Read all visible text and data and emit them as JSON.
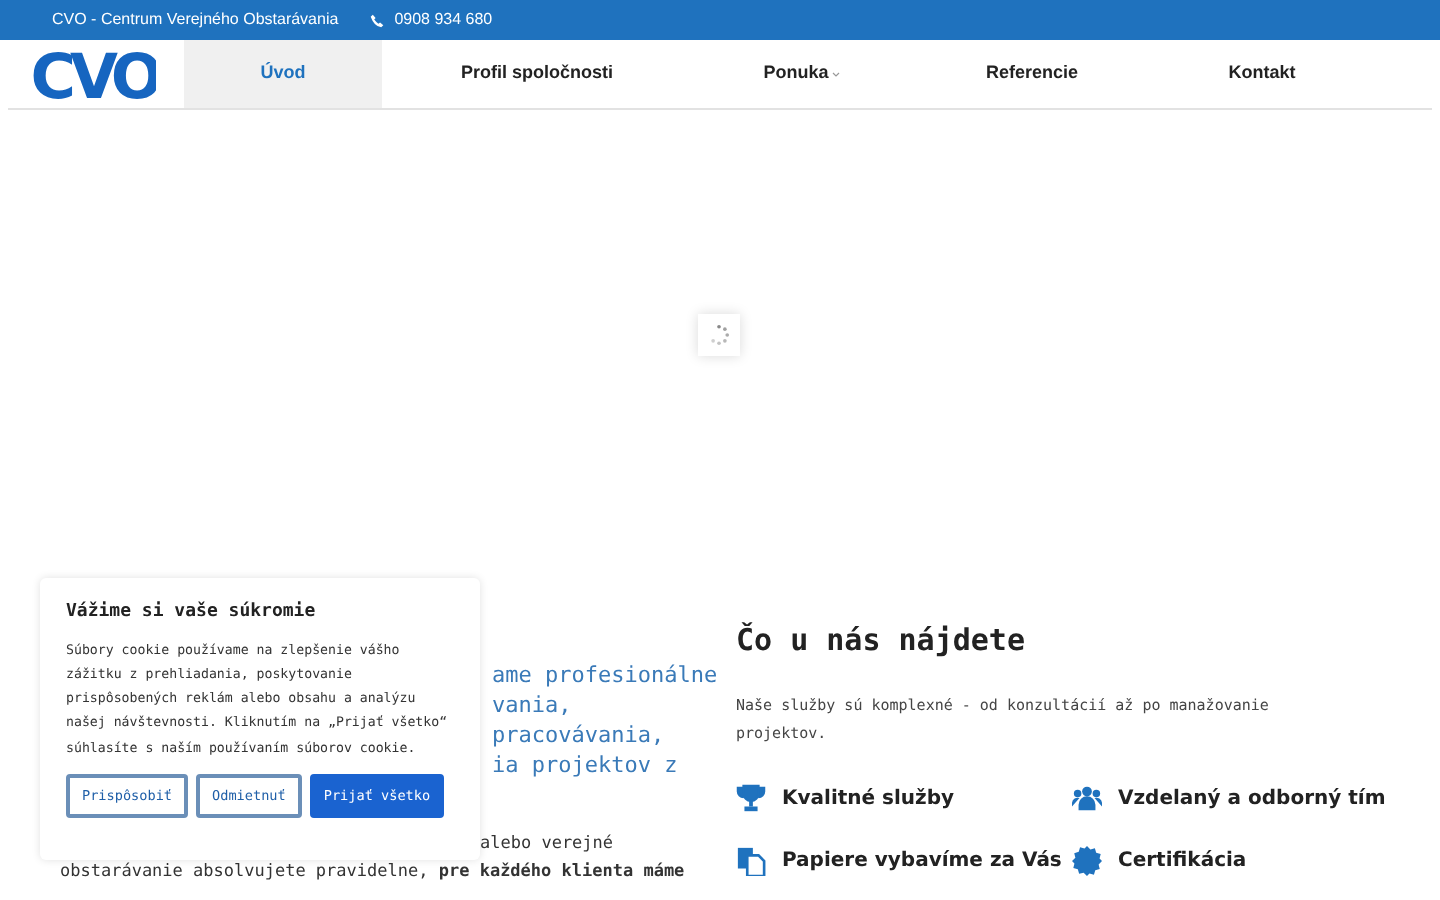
{
  "top_bar": {
    "company": "CVO - Centrum Verejného Obstarávania",
    "phone": "0908 934 680"
  },
  "logo": {
    "text": "CVO"
  },
  "nav": [
    {
      "label": "Úvod",
      "selected": true,
      "dropdown": false
    },
    {
      "label": "Profil spoločnosti",
      "selected": false,
      "dropdown": false
    },
    {
      "label": "Ponuka",
      "selected": false,
      "dropdown": true
    },
    {
      "label": "Referencie",
      "selected": false,
      "dropdown": false
    },
    {
      "label": "Kontakt",
      "selected": false,
      "dropdown": false
    }
  ],
  "intro": {
    "heading_lines": [
      "ame profesionálne",
      "vania,",
      "pracovávania,",
      "ia projektov z"
    ],
    "paragraph_lines": [
      "alebo verejné",
      "obstarávanie absolvujete pravidelne, **pre každého klienta máme**"
    ]
  },
  "services": {
    "title": "Čo u nás nájdete",
    "description": "Naše služby sú komplexné - od konzultácií až po manažovanie projektov.",
    "features": [
      {
        "kind": "trophy",
        "label": "Kvalitné služby"
      },
      {
        "kind": "team",
        "label": "Vzdelaný a odborný tím"
      },
      {
        "kind": "document",
        "label": "Papiere vybavíme za Vás"
      },
      {
        "kind": "certificate",
        "label": "Certifikácia"
      }
    ]
  },
  "cookie_banner": {
    "title": "Vážime si vaše súkromie",
    "text": "Súbory cookie používame na zlepšenie vášho zážitku z prehliadania, poskytovanie prispôsobených reklám alebo obsahu a analýzu našej návštevnosti. Kliknutím na „Prijať všetko“ súhlasíte s naším používaním súborov cookie.",
    "buttons": [
      {
        "label": "Prispôsobiť",
        "kind": "outline"
      },
      {
        "label": "Odmietnuť",
        "kind": "outline"
      },
      {
        "label": "Prijať všetko",
        "kind": "primary"
      }
    ]
  }
}
